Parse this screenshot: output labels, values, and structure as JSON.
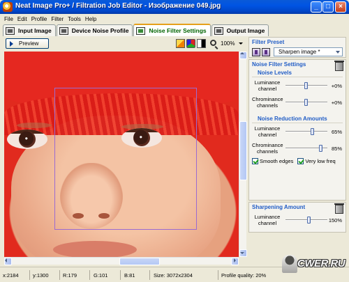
{
  "window": {
    "title": "Neat Image Pro+ / Filtration Job Editor - Изображение 049.jpg",
    "buttons": [
      "minimize",
      "maximize",
      "close"
    ]
  },
  "menu": [
    "File",
    "Edit",
    "Profile",
    "Filter",
    "Tools",
    "Help"
  ],
  "tabs": [
    {
      "label": "Input Image",
      "active": false
    },
    {
      "label": "Device Noise Profile",
      "active": false
    },
    {
      "label": "Noise Filter Settings",
      "active": true
    },
    {
      "label": "Output Image",
      "active": false
    }
  ],
  "toolbar": {
    "preview_label": "Preview",
    "zoom": "100%"
  },
  "panel": {
    "filter_preset": {
      "heading": "Filter Preset",
      "selected": "Sharpen image *"
    },
    "noise_filter_settings": {
      "heading": "Noise Filter Settings",
      "noise_levels": {
        "heading": "Noise Levels",
        "rows": [
          {
            "label": "Luminance channel",
            "value": "+0%",
            "position": 0.5
          },
          {
            "label": "Chrominance channels",
            "value": "+0%",
            "position": 0.5
          }
        ]
      },
      "noise_reduction": {
        "heading": "Noise Reduction Amounts",
        "rows": [
          {
            "label": "Luminance channel",
            "value": "65%",
            "position": 0.65
          },
          {
            "label": "Chrominance channels",
            "value": "85%",
            "position": 0.85
          }
        ]
      },
      "checks": [
        {
          "label": "Smooth edges",
          "checked": true
        },
        {
          "label": "Very low freq",
          "checked": true
        }
      ]
    },
    "sharpening": {
      "heading": "Sharpening Amount",
      "rows": [
        {
          "label": "Luminance channel",
          "value": "150%",
          "position": 0.55
        }
      ]
    }
  },
  "status": {
    "x": "x:2184",
    "y": "y:1300",
    "r": "R:179",
    "g": "G:101",
    "b": "B:81",
    "size": "Size: 3072x2304",
    "profile_quality": "Profile quality: 20%",
    "watermark": "CWER.RU"
  }
}
